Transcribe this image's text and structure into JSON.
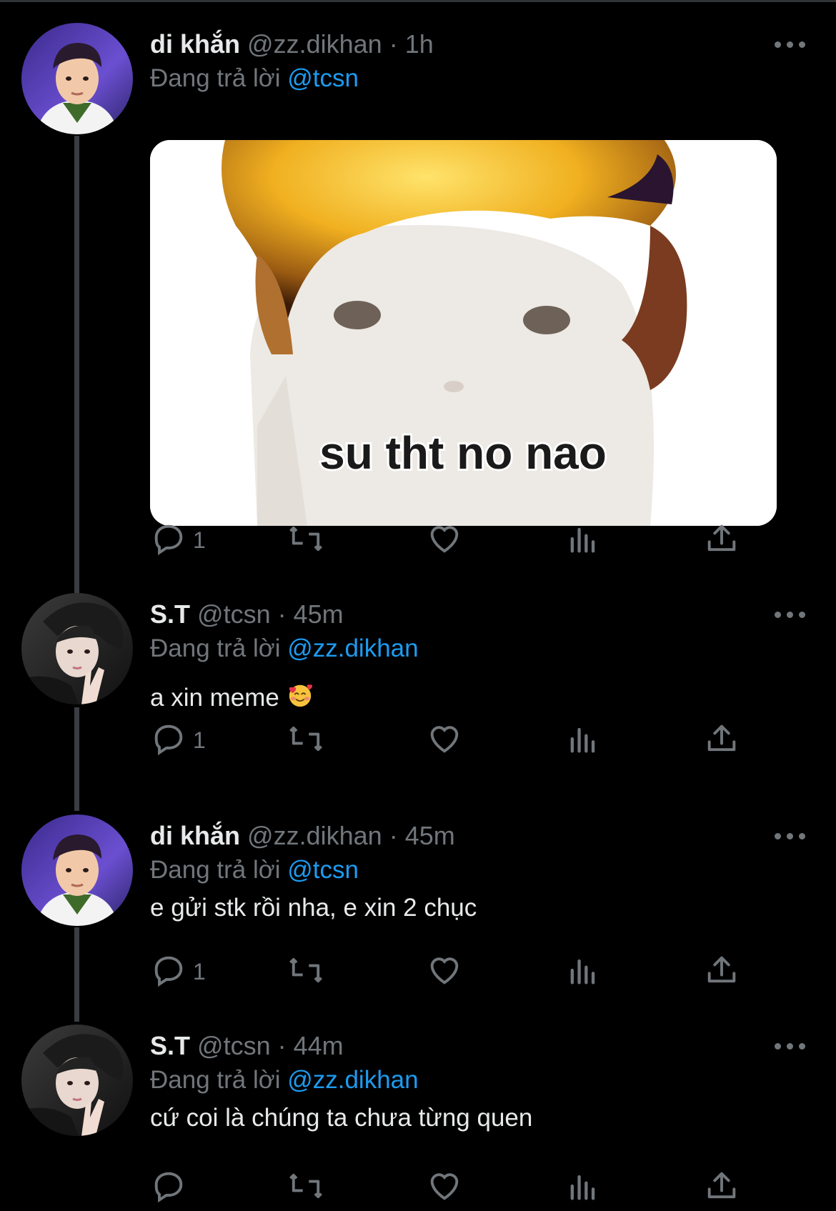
{
  "tweets": [
    {
      "name": "di khắn",
      "handle": "@zz.dikhan",
      "time": "1h",
      "replying_prefix": "Đang trả lời ",
      "replying_to": "@tcsn",
      "media_caption": "su tht no nao",
      "replies": "1",
      "retweets": "",
      "likes": ""
    },
    {
      "name": "S.T",
      "handle": "@tcsn",
      "time": "45m",
      "replying_prefix": "Đang trả lời ",
      "replying_to": "@zz.dikhan",
      "text": "a xin meme",
      "emoji": "smiling-face-with-hearts",
      "replies": "1"
    },
    {
      "name": "di khắn",
      "handle": "@zz.dikhan",
      "time": "45m",
      "replying_prefix": "Đang trả lời ",
      "replying_to": "@tcsn",
      "text": "e gửi stk rồi nha, e xin 2 chục",
      "replies": "1"
    },
    {
      "name": "S.T",
      "handle": "@tcsn",
      "time": "44m",
      "replying_prefix": "Đang trả lời ",
      "replying_to": "@zz.dikhan",
      "text": "cứ coi là chúng ta chưa từng quen",
      "replies": ""
    }
  ],
  "separator": " · ",
  "colors": {
    "background": "#000000",
    "primary_text": "#e7e9ea",
    "secondary_text": "#71767b",
    "link": "#1d9bf0",
    "thread_line": "#3a3d41"
  },
  "icons": [
    "more-icon",
    "reply-icon",
    "retweet-icon",
    "like-icon",
    "views-icon",
    "share-icon"
  ]
}
